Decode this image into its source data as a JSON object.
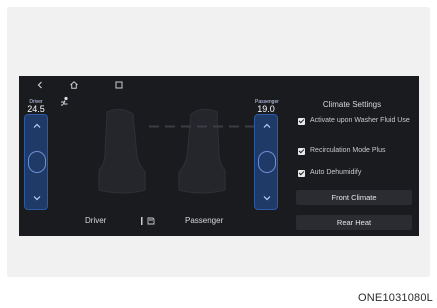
{
  "nav": {
    "back_icon": "back-arrow-icon",
    "home_icon": "home-icon",
    "menu_icon": "menu-icon"
  },
  "driver": {
    "temp_label": "Driver",
    "temp_value": "24.5"
  },
  "passenger": {
    "temp_label": "Passenger",
    "temp_value": "19.0"
  },
  "bottom": {
    "driver_label": "Driver",
    "passenger_label": "Passenger",
    "sync_icon": "sync-icon"
  },
  "settings": {
    "title": "Climate Settings",
    "options": [
      {
        "label": "Activate upon Washer Fluid Use",
        "checked": true
      },
      {
        "label": "Recirculation Mode Plus",
        "checked": true
      },
      {
        "label": "Auto Dehumidify",
        "checked": true
      }
    ],
    "buttons": [
      "Front Climate",
      "Rear Heat"
    ]
  },
  "figure_code": "ONE1031080L",
  "colors": {
    "screen_bg": "#1a1b1e",
    "temp_accent": "#1f3a66",
    "panel_button": "#2a2c31"
  }
}
